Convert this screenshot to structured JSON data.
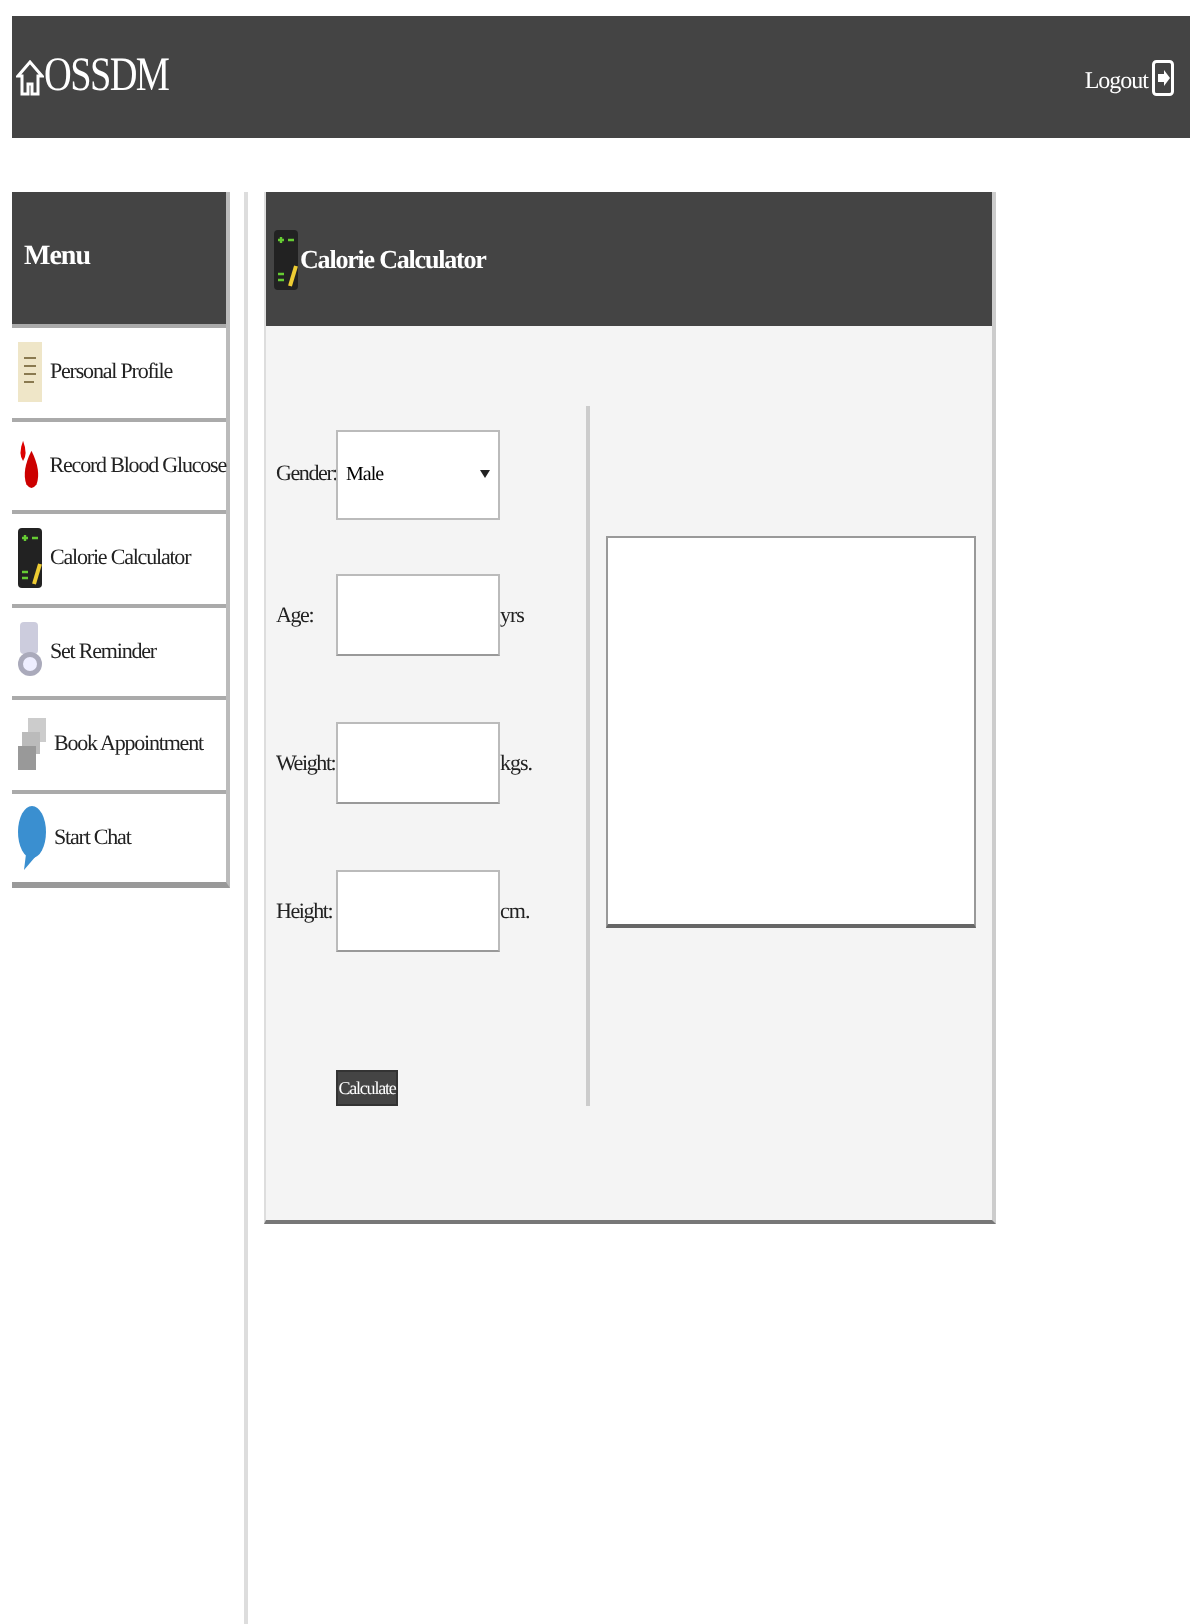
{
  "header": {
    "brand": "OSSDM",
    "logout": "Logout"
  },
  "sidebar": {
    "title": "Menu",
    "items": [
      {
        "label": "Personal Profile",
        "selected": false
      },
      {
        "label": "Record Blood Glucose",
        "selected": false
      },
      {
        "label": "Calorie Calculator",
        "selected": false
      },
      {
        "label": "Set Reminder",
        "selected": false
      },
      {
        "label": "Book Appointment",
        "selected": false
      },
      {
        "label": "Start Chat",
        "selected": false
      }
    ]
  },
  "panel": {
    "title": "Calorie Calculator",
    "fields": [
      {
        "kind": "select",
        "label": "Gender:",
        "value": "Male"
      },
      {
        "kind": "input",
        "label": "Age:",
        "unit": "yrs"
      },
      {
        "kind": "input",
        "label": "Weight:",
        "unit": "kgs."
      },
      {
        "kind": "input",
        "label": "Height:",
        "unit": "cm."
      }
    ],
    "button": "Calculate"
  }
}
